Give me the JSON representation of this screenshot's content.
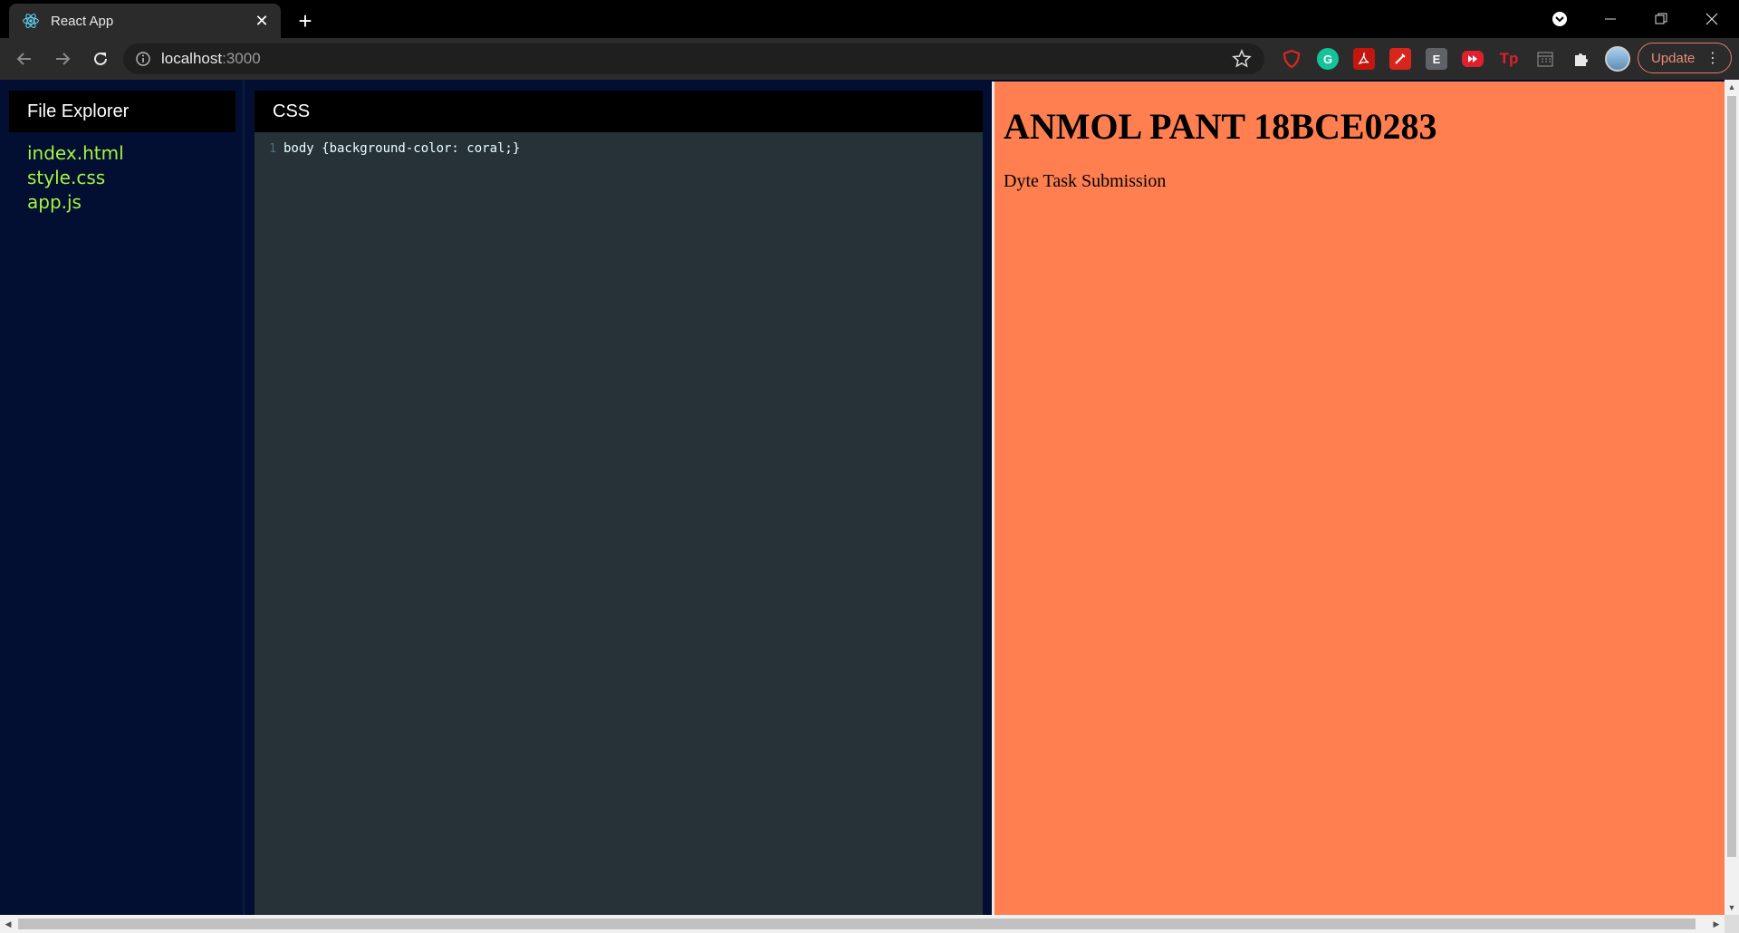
{
  "browser": {
    "tab_title": "React App",
    "url_host": "localhost",
    "url_port": ":3000",
    "update_label": "Update",
    "extensions": [
      {
        "icon": "ublock-icon",
        "color": "#d9261c"
      },
      {
        "icon": "grammarly-icon",
        "label": "G",
        "color": "#15c39a"
      },
      {
        "icon": "acrobat-icon",
        "color": "#c4160e"
      },
      {
        "icon": "pen-icon",
        "color": "#d9261c"
      },
      {
        "icon": "e-extension-icon",
        "label": "E",
        "color": "#5f6368"
      },
      {
        "icon": "video-icon",
        "color": "#e0202f"
      },
      {
        "icon": "tp-icon",
        "label": "Tp",
        "color": "#e0202f"
      },
      {
        "icon": "calendar-icon",
        "color": "#8a8a8a"
      },
      {
        "icon": "puzzle-icon",
        "color": "#e8e8e8"
      },
      {
        "icon": "profile-avatar-icon",
        "color": "#7fb3d5"
      }
    ]
  },
  "explorer": {
    "title": "File Explorer",
    "files": [
      "index.html",
      "style.css",
      "app.js"
    ]
  },
  "editor": {
    "title": "CSS",
    "lines": [
      {
        "number": "1",
        "code": "body {background-color: coral;}"
      }
    ]
  },
  "preview": {
    "background": "coral",
    "heading": "ANMOL PANT 18BCE0283",
    "paragraph": "Dyte Task Submission"
  },
  "colors": {
    "app_bg": "#020f33",
    "editor_bg": "#263238",
    "file_link": "#a6f53c"
  }
}
